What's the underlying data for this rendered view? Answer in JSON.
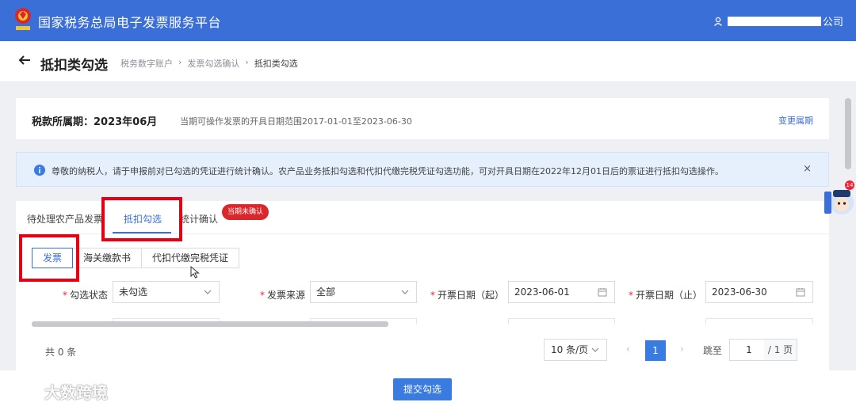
{
  "header": {
    "app_title": "国家税务总局电子发票服务平台",
    "user_suffix": "公司"
  },
  "page": {
    "title": "抵扣类勾选",
    "breadcrumbs": [
      "税务数字账户",
      "发票勾选确认",
      "抵扣类勾选"
    ],
    "breadcrumb_separator": "›"
  },
  "period": {
    "label": "税款所属期：2023年06月",
    "note": "当期可操作发票的开具日期范围2017-01-01至2023-06-30",
    "change_link": "变更属期"
  },
  "notice": {
    "text": "尊敬的纳税人，请于申报前对已勾选的凭证进行统计确认。农产品业务抵扣勾选和代扣代缴完税凭证勾选功能，可对开具日期在2022年12月01日后的票证进行抵扣勾选操作。",
    "close": "×"
  },
  "tabs": {
    "items": [
      "待处理农产品发票",
      "抵扣勾选",
      "统计确认"
    ],
    "active": "抵扣勾选",
    "badge": "当期未确认"
  },
  "subtabs": {
    "items": [
      "发票",
      "海关缴款书",
      "代扣代缴完税凭证"
    ],
    "active": "发票"
  },
  "filters": {
    "required_mark": "*",
    "status_label": "勾选状态",
    "status_value": "未勾选",
    "source_label": "发票来源",
    "source_value": "全部",
    "date_start_label": "开票日期（起）",
    "date_start_value": "2023-06-01",
    "date_end_label": "开票日期（止）",
    "date_end_value": "2023-06-30"
  },
  "pagination": {
    "total": "共 0 条",
    "page_size": "10 条/页",
    "prev": "‹",
    "current": "1",
    "next": "›",
    "jump_label": "跳至",
    "jump_value": "1",
    "jump_total": "/ 1 页"
  },
  "actions": {
    "submit": "提交勾选"
  },
  "helper": {
    "count": "14"
  },
  "watermark": {
    "text": "大数跨境"
  },
  "colors": {
    "brand_blue": "#3a6fd8",
    "highlight_red": "#e60012",
    "badge_red": "#d9272b",
    "notice_bg": "#e6f0fc"
  },
  "icons": [
    "tax-emblem-icon",
    "user-icon",
    "back-arrow-icon",
    "info-icon",
    "close-icon",
    "chevron-down-icon",
    "calendar-icon",
    "mouse-cursor-icon",
    "helper-avatar-icon"
  ]
}
